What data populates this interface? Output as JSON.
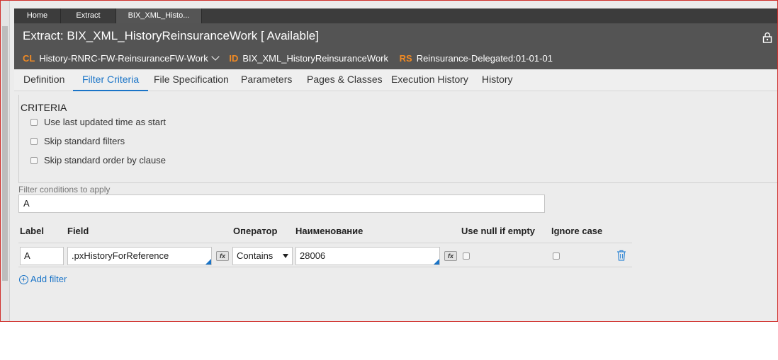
{
  "window_tabs": [
    {
      "label": "Home"
    },
    {
      "label": "Extract"
    },
    {
      "label": "BIX_XML_Histo..."
    }
  ],
  "header": {
    "title": "Extract:  BIX_XML_HistoryReinsuranceWork [ Available]",
    "cl_key": "CL",
    "cl_value": "History-RNRC-FW-ReinsuranceFW-Work",
    "id_key": "ID",
    "id_value": "BIX_XML_HistoryReinsuranceWork",
    "rs_key": "RS",
    "rs_value": "Reinsurance-Delegated:01-01-01",
    "lock_icon": "lock-icon",
    "accent_color": "#f08a24"
  },
  "tabs": [
    {
      "label": "Definition"
    },
    {
      "label": "Filter Criteria",
      "active": true
    },
    {
      "label": "File Specification"
    },
    {
      "label": "Parameters"
    },
    {
      "label": "Pages & Classes"
    },
    {
      "label": "Execution History"
    },
    {
      "label": "History"
    }
  ],
  "criteria": {
    "title": "CRITERIA",
    "options": [
      {
        "label": "Use last updated time as start",
        "checked": false
      },
      {
        "label": "Skip standard filters",
        "checked": false
      },
      {
        "label": "Skip standard order by clause",
        "checked": false
      }
    ]
  },
  "filter_conditions": {
    "label": "Filter conditions to apply",
    "value": "A"
  },
  "filter_table": {
    "headers": {
      "label": "Label",
      "field": "Field",
      "operator": "Оператор",
      "name": "Наименование",
      "use_null": "Use null if empty",
      "ignore_case": "Ignore case"
    },
    "rows": [
      {
        "label": "A",
        "field": ".pxHistoryForReference",
        "operator": "Contains",
        "value": "28006",
        "use_null": false,
        "ignore_case": false
      }
    ]
  },
  "add_filter_label": "Add filter",
  "fx_label": "fx",
  "link_color": "#1a74c7"
}
